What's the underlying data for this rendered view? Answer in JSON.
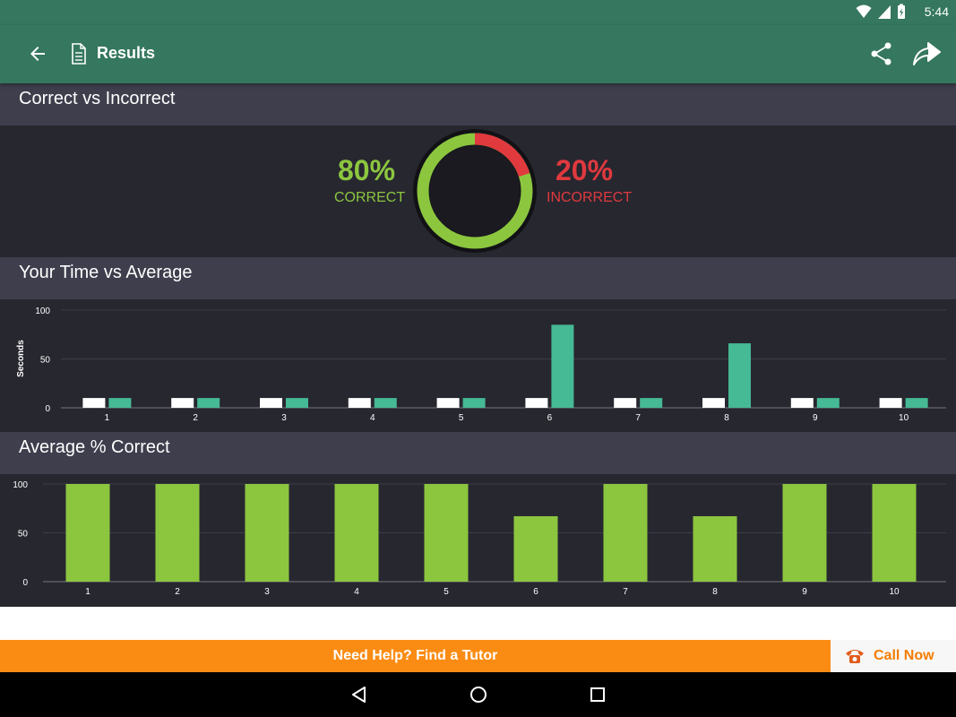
{
  "status_bar": {
    "time": "5:44"
  },
  "app_bar": {
    "title": "Results"
  },
  "sections": {
    "correct_vs_incorrect": {
      "title": "Correct vs Incorrect",
      "correct_pct": "80%",
      "correct_label": "CORRECT",
      "incorrect_pct": "20%",
      "incorrect_label": "INCORRECT"
    },
    "time_vs_average": {
      "title": "Your Time vs Average"
    },
    "average_correct": {
      "title": "Average % Correct"
    }
  },
  "footer": {
    "tutor_label": "Need Help? Find a Tutor",
    "call_label": "Call Now"
  },
  "colors": {
    "app_bar": "#35775f",
    "correct": "#8cc63f",
    "incorrect": "#e0393e",
    "average_bar": "#46b995",
    "your_bar": "#ffffff",
    "accent_orange": "#fb8c13",
    "panel": "#272730",
    "section_head": "#3e3e4d"
  },
  "chart_data": [
    {
      "type": "pie",
      "categories": [
        "CORRECT",
        "INCORRECT"
      ],
      "values": [
        80,
        20
      ]
    },
    {
      "type": "bar",
      "categories": [
        "1",
        "2",
        "3",
        "4",
        "5",
        "6",
        "7",
        "8",
        "9",
        "10"
      ],
      "ylabel": "Seconds",
      "ylim": [
        0,
        100
      ],
      "yticks": [
        "0",
        "50",
        "100"
      ],
      "series": [
        {
          "values": [
            10,
            10,
            10,
            10,
            10,
            10,
            10,
            10,
            10,
            10
          ]
        },
        {
          "values": [
            10,
            10,
            10,
            10,
            10,
            85,
            10,
            66,
            10,
            10
          ]
        }
      ],
      "grid": true
    },
    {
      "type": "bar",
      "categories": [
        "1",
        "2",
        "3",
        "4",
        "5",
        "6",
        "7",
        "8",
        "9",
        "10"
      ],
      "ylim": [
        0,
        100
      ],
      "yticks": [
        "0",
        "50",
        "100"
      ],
      "values": [
        100,
        100,
        100,
        100,
        100,
        67,
        100,
        67,
        100,
        100
      ],
      "grid": true
    }
  ]
}
